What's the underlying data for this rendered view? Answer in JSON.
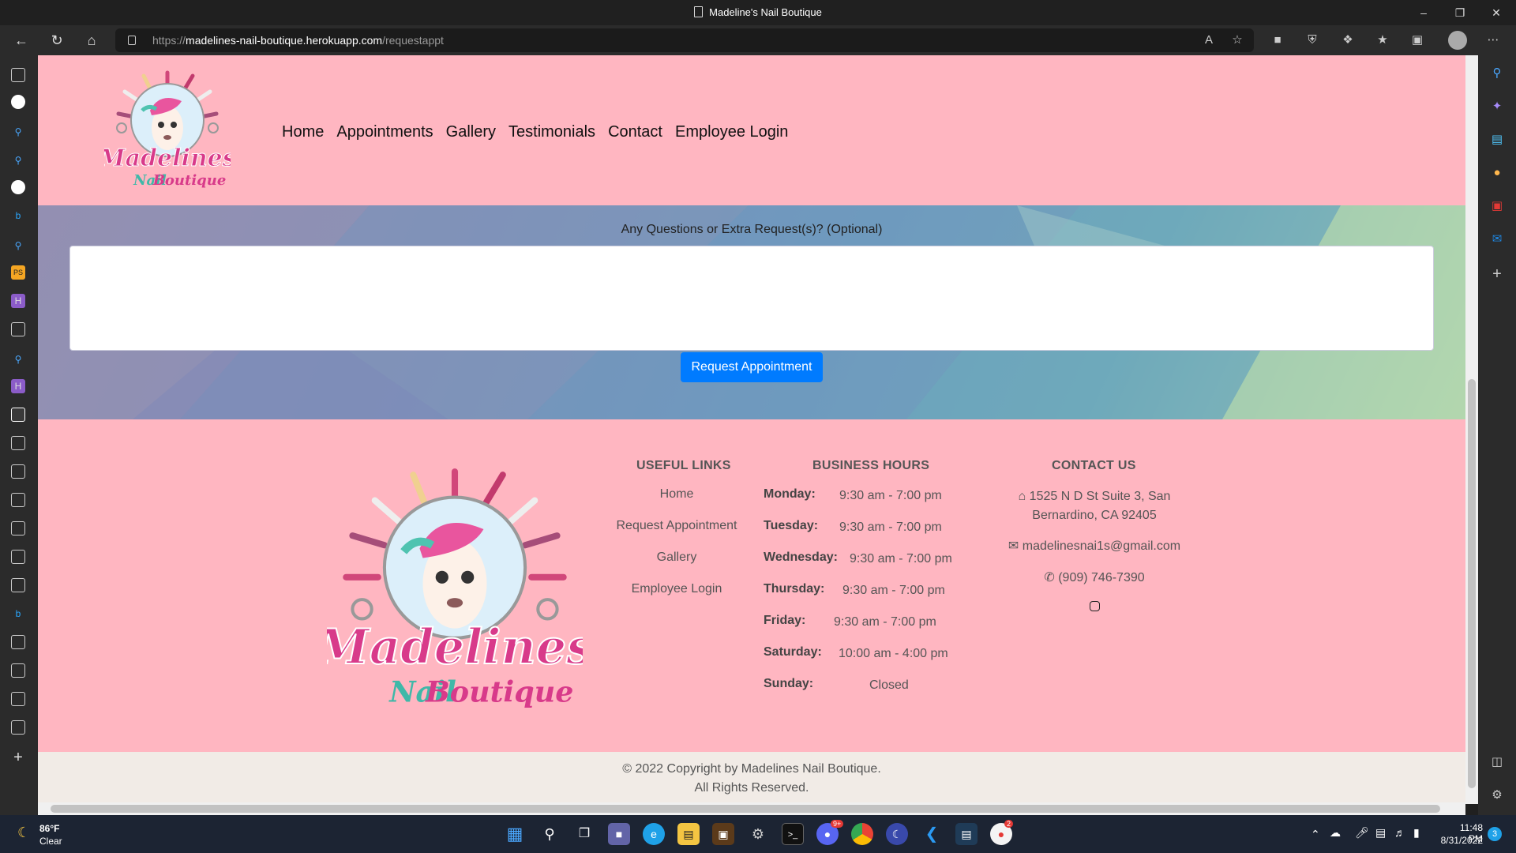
{
  "window": {
    "title": "Madeline's Nail Boutique"
  },
  "browser": {
    "url_scheme": "https://",
    "url_host": "madelines-nail-boutique.herokuapp.com",
    "url_path": "/requestappt"
  },
  "header": {
    "nav": [
      "Home",
      "Appointments",
      "Gallery",
      "Testimonials",
      "Contact",
      "Employee Login"
    ]
  },
  "logo": {
    "line1": "Madelines",
    "line2a": "Nail",
    "line2b": "Boutique"
  },
  "form": {
    "question_label": "Any Questions or Extra Request(s)? (Optional)",
    "submit_label": "Request Appointment"
  },
  "footer": {
    "useful_links_title": "USEFUL LINKS",
    "useful_links": [
      "Home",
      "Request Appointment",
      "Gallery",
      "Employee Login"
    ],
    "hours_title": "BUSINESS HOURS",
    "hours": [
      {
        "day": "Monday:",
        "time": "9:30 am - 7:00 pm"
      },
      {
        "day": "Tuesday:",
        "time": "9:30 am - 7:00 pm"
      },
      {
        "day": "Wednesday:",
        "time": "9:30 am - 7:00 pm"
      },
      {
        "day": "Thursday:",
        "time": "9:30 am - 7:00 pm"
      },
      {
        "day": "Friday:",
        "time": "9:30 am - 7:00 pm"
      },
      {
        "day": "Saturday:",
        "time": "10:00 am - 4:00 pm"
      },
      {
        "day": "Sunday:",
        "time": "Closed"
      }
    ],
    "contact_title": "CONTACT US",
    "address_line1": "1525 N D St Suite 3, San",
    "address_line2": "Bernardino, CA 92405",
    "email": "madelinesnai1s@gmail.com",
    "phone": "(909) 746-7390",
    "copyright_line1": "© 2022 Copyright by Madelines Nail Boutique.",
    "copyright_line2": "All Rights Reserved."
  },
  "taskbar": {
    "weather_temp": "86°F",
    "weather_desc": "Clear",
    "time": "11:48 PM",
    "date": "8/31/2022",
    "notification_count": "3",
    "discord_badge": "9+",
    "app_badge": "2"
  },
  "colors": {
    "page_pink": "#ffb6c1",
    "button_blue": "#007bff",
    "footer_gray": "#f1ebe6"
  }
}
